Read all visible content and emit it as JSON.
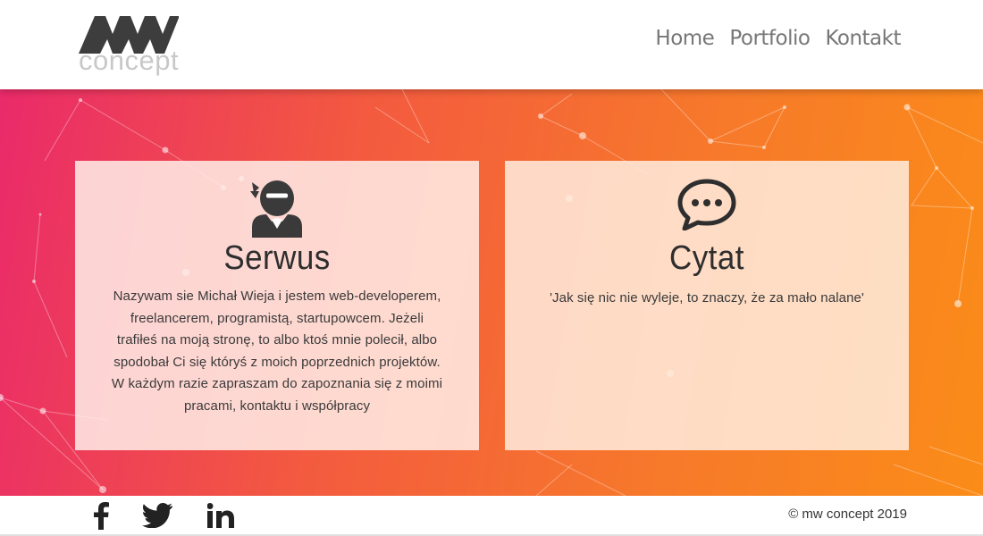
{
  "header": {
    "logo_text": "concept",
    "logo_mark": "MW",
    "nav": [
      {
        "label": "Home"
      },
      {
        "label": "Portfolio"
      },
      {
        "label": "Kontakt"
      }
    ]
  },
  "cards": [
    {
      "icon": "ninja-icon",
      "title": "Serwus",
      "text": "Nazywam sie Michał Wieja i jestem web-developerem, freelancerem, programistą, startupowcem. Jeżeli trafiłeś na moją stronę, to albo ktoś mnie polecił, albo spodobał Ci się któryś z moich poprzednich projektów. W każdym razie zapraszam do zapoznania się z moimi pracami, kontaktu i współpracy"
    },
    {
      "icon": "speech-bubble-icon",
      "title": "Cytat",
      "text": "'Jak się nic nie wyleje, to znaczy, że za mało nalane'"
    }
  ],
  "footer": {
    "social": [
      {
        "icon": "facebook-icon"
      },
      {
        "icon": "twitter-icon"
      },
      {
        "icon": "linkedin-icon"
      }
    ],
    "copyright": "© mw concept 2019"
  },
  "colors": {
    "gradient_start": "#ea2a6a",
    "gradient_end": "#fb8c18",
    "nav_text": "#777777",
    "logo_gray": "#c8c8c8"
  }
}
